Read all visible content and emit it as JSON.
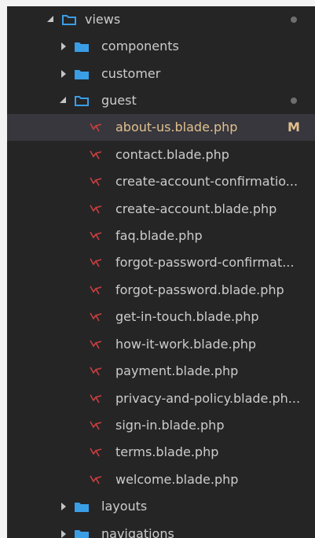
{
  "explorer": {
    "views": {
      "label": "views"
    },
    "components": {
      "label": "components"
    },
    "customer": {
      "label": "customer"
    },
    "guest": {
      "label": "guest"
    },
    "files": [
      {
        "label": "about-us.blade.php",
        "badge": "M"
      },
      {
        "label": "contact.blade.php"
      },
      {
        "label": "create-account-confirmatio..."
      },
      {
        "label": "create-account.blade.php"
      },
      {
        "label": "faq.blade.php"
      },
      {
        "label": "forgot-password-confirmat..."
      },
      {
        "label": "forgot-password.blade.php"
      },
      {
        "label": "get-in-touch.blade.php"
      },
      {
        "label": "how-it-work.blade.php"
      },
      {
        "label": "payment.blade.php"
      },
      {
        "label": "privacy-and-policy.blade.ph..."
      },
      {
        "label": "sign-in.blade.php"
      },
      {
        "label": "terms.blade.php"
      },
      {
        "label": "welcome.blade.php"
      }
    ],
    "layouts": {
      "label": "layouts"
    },
    "navigations": {
      "label": "navigations"
    }
  },
  "colors": {
    "background": "#252526",
    "text": "#cccccc",
    "modified": "#e2c08d",
    "folder_closed": "#3a9ee7",
    "folder_open": "#3a9ee7",
    "file_icon": "#c93f3f",
    "dot": "#6e6e6e"
  },
  "icons": {
    "folder_open": "folder-open-icon",
    "folder_closed": "folder-icon",
    "file": "laravel-blade-icon",
    "expanded": "chevron-down-icon",
    "collapsed": "chevron-right-icon"
  }
}
